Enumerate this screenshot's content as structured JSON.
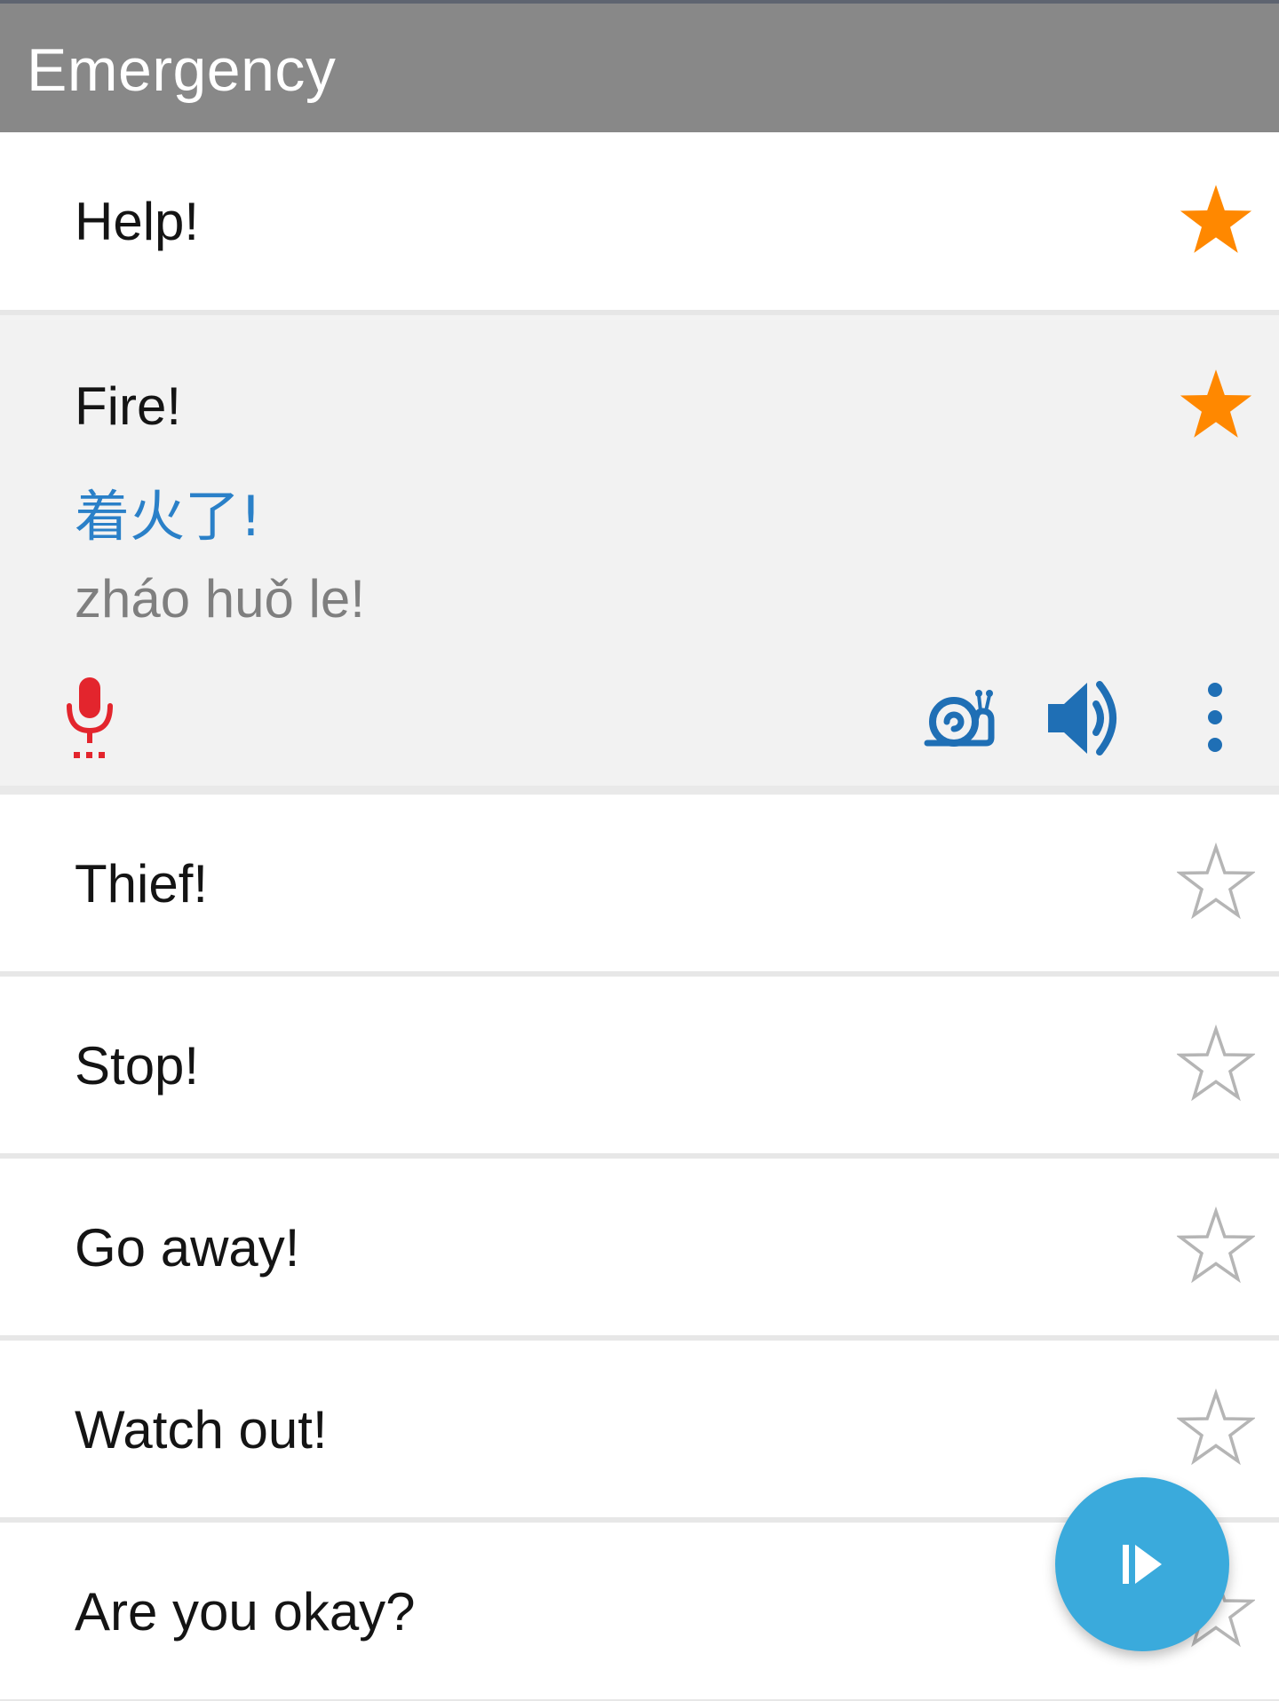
{
  "toolbar": {
    "title": "Emergency"
  },
  "colors": {
    "toolbar_bg": "#888888",
    "star_filled": "#ff8800",
    "star_outline": "#b5b5b5",
    "translation": "#2a80c8",
    "romanization": "#7f7f7f",
    "mic": "#e3252d",
    "action_blue": "#1f6fb5",
    "fab": "#3aaadc"
  },
  "phrases": [
    {
      "label": "Help!",
      "favorite": true
    },
    {
      "label": "Fire!",
      "favorite": true,
      "expanded": true,
      "translation": "着火了!",
      "romanization": "zháo huǒ le!",
      "actions": {
        "record_icon": "microphone-icon",
        "slow_icon": "snail-icon",
        "play_icon": "speaker-icon",
        "more_icon": "more-vertical-icon"
      }
    },
    {
      "label": "Thief!",
      "favorite": false
    },
    {
      "label": "Stop!",
      "favorite": false
    },
    {
      "label": "Go away!",
      "favorite": false
    },
    {
      "label": "Watch out!",
      "favorite": false
    },
    {
      "label": "Are you okay?",
      "favorite": false
    }
  ],
  "fab": {
    "icon": "play-next-icon"
  }
}
